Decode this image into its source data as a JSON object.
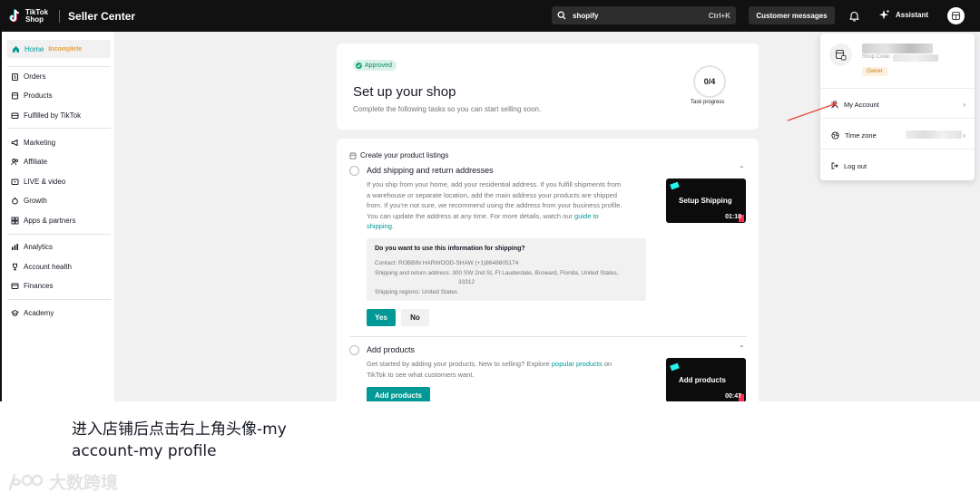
{
  "topbar": {
    "brand_line1": "TikTok",
    "brand_line2": "Shop",
    "title": "Seller Center",
    "search_value": "shopify",
    "search_shortcut": "Ctrl+K",
    "customer_messages": "Customer messages",
    "assistant": "Assistant"
  },
  "sidebar": {
    "home": {
      "label": "Home",
      "badge": "Incomplete"
    },
    "items": [
      {
        "label": "Orders",
        "icon": "clipboard-icon"
      },
      {
        "label": "Products",
        "icon": "box-icon"
      },
      {
        "label": "Fulfilled by TikTok",
        "icon": "truck-icon"
      },
      {
        "label": "Marketing",
        "icon": "megaphone-icon"
      },
      {
        "label": "Affiliate",
        "icon": "people-icon"
      },
      {
        "label": "LIVE & video",
        "icon": "video-icon"
      },
      {
        "label": "Growth",
        "icon": "plant-icon"
      },
      {
        "label": "Apps & partners",
        "icon": "grid-icon"
      },
      {
        "label": "Analytics",
        "icon": "chart-icon"
      },
      {
        "label": "Account health",
        "icon": "trophy-icon"
      },
      {
        "label": "Finances",
        "icon": "wallet-icon"
      },
      {
        "label": "Academy",
        "icon": "graduation-icon"
      }
    ]
  },
  "setup": {
    "badge": "Approved",
    "title": "Set up your shop",
    "subtitle": "Complete the following tasks so you can start selling soon.",
    "progress": "0/4",
    "progress_label": "Task progress"
  },
  "listings": {
    "section_title": "Create your product listings",
    "task1": {
      "title": "Add shipping and return addresses",
      "desc1": "If you ship from your home, add your residential address. If you fulfill shipments from",
      "desc2": "a warehouse or separate location, add the main address your products are shipped",
      "desc3": "from. If you're not sure, we recommend using the address from your business profile.",
      "desc4": "You can update the address at any time. For more details, watch our",
      "link1": "guide to",
      "link2": "shipping",
      "desc_end": ".",
      "video_title": "Setup Shipping",
      "video_time": "01:10",
      "confirm_question": "Do you want to use this information for shipping?",
      "contact": "Contact: ROBBIN HARWOOD-SHAW (+1)8648605174",
      "address1": "Shipping and return address: 300 SW 2nd St, Ft Lauderdale, Broward, Florida, United States,",
      "address2": "33312",
      "regions": "Shipping regions: United States",
      "yes": "Yes",
      "no": "No"
    },
    "task2": {
      "title": "Add products",
      "desc1a": "Get started by adding your products. New to selling? Explore",
      "link": "popular products",
      "desc1b": "on",
      "desc2": "TikTok to see what customers want.",
      "button": "Add products",
      "video_title": "Add products",
      "video_time": "00:47"
    }
  },
  "account_menu": {
    "shop_code_label": "Shop Code:",
    "role": "Owner",
    "my_account": "My Account",
    "time_zone": "Time zone",
    "log_out": "Log out"
  },
  "caption": {
    "line1": "进入店铺后点击右上角头像-my",
    "line2": "account-my profile"
  },
  "watermark": "大数跨境",
  "colors": {
    "accent": "#009995",
    "topbar": "#111111",
    "annotation_arrow": "#e03c31"
  }
}
